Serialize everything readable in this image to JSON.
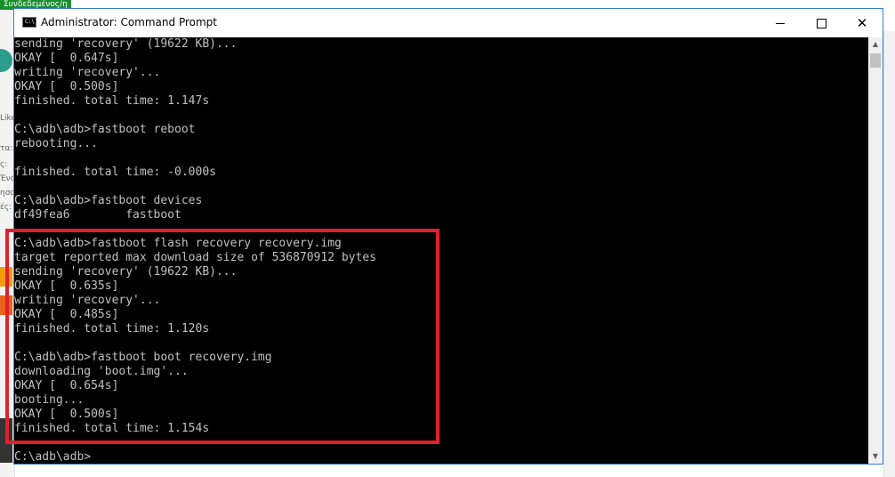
{
  "background": {
    "status_badge": "Συνδεδεμένος/η",
    "side_fragments": [
      "Like",
      "τα:",
      "ς:",
      "Ένα",
      "ησο",
      "ές:"
    ]
  },
  "window": {
    "title": "Administrator: Command Prompt",
    "icon": "cmd-icon",
    "icon_label": "C:\\",
    "controls": {
      "minimize": "minimize-icon",
      "maximize": "maximize-icon",
      "close": "close-icon",
      "close_glyph": "✕"
    }
  },
  "console": {
    "text_color": "#c0c0c0",
    "background_color": "#000000",
    "lines": [
      "sending 'recovery' (19622 KB)...",
      "OKAY [  0.647s]",
      "writing 'recovery'...",
      "OKAY [  0.500s]",
      "finished. total time: 1.147s",
      "",
      "C:\\adb\\adb>fastboot reboot",
      "rebooting...",
      "",
      "finished. total time: -0.000s",
      "",
      "C:\\adb\\adb>fastboot devices",
      "df49fea6        fastboot",
      "",
      "C:\\adb\\adb>fastboot flash recovery recovery.img",
      "target reported max download size of 536870912 bytes",
      "sending 'recovery' (19622 KB)...",
      "OKAY [  0.635s]",
      "writing 'recovery'...",
      "OKAY [  0.485s]",
      "finished. total time: 1.120s",
      "",
      "C:\\adb\\adb>fastboot boot recovery.img",
      "downloading 'boot.img'...",
      "OKAY [  0.654s]",
      "booting...",
      "OKAY [  0.500s]",
      "finished. total time: 1.154s",
      "",
      "C:\\adb\\adb>"
    ]
  },
  "scrollbar": {
    "up_glyph": "▲",
    "down_glyph": "▼"
  },
  "annotation": {
    "highlight_color": "#e0202a"
  }
}
